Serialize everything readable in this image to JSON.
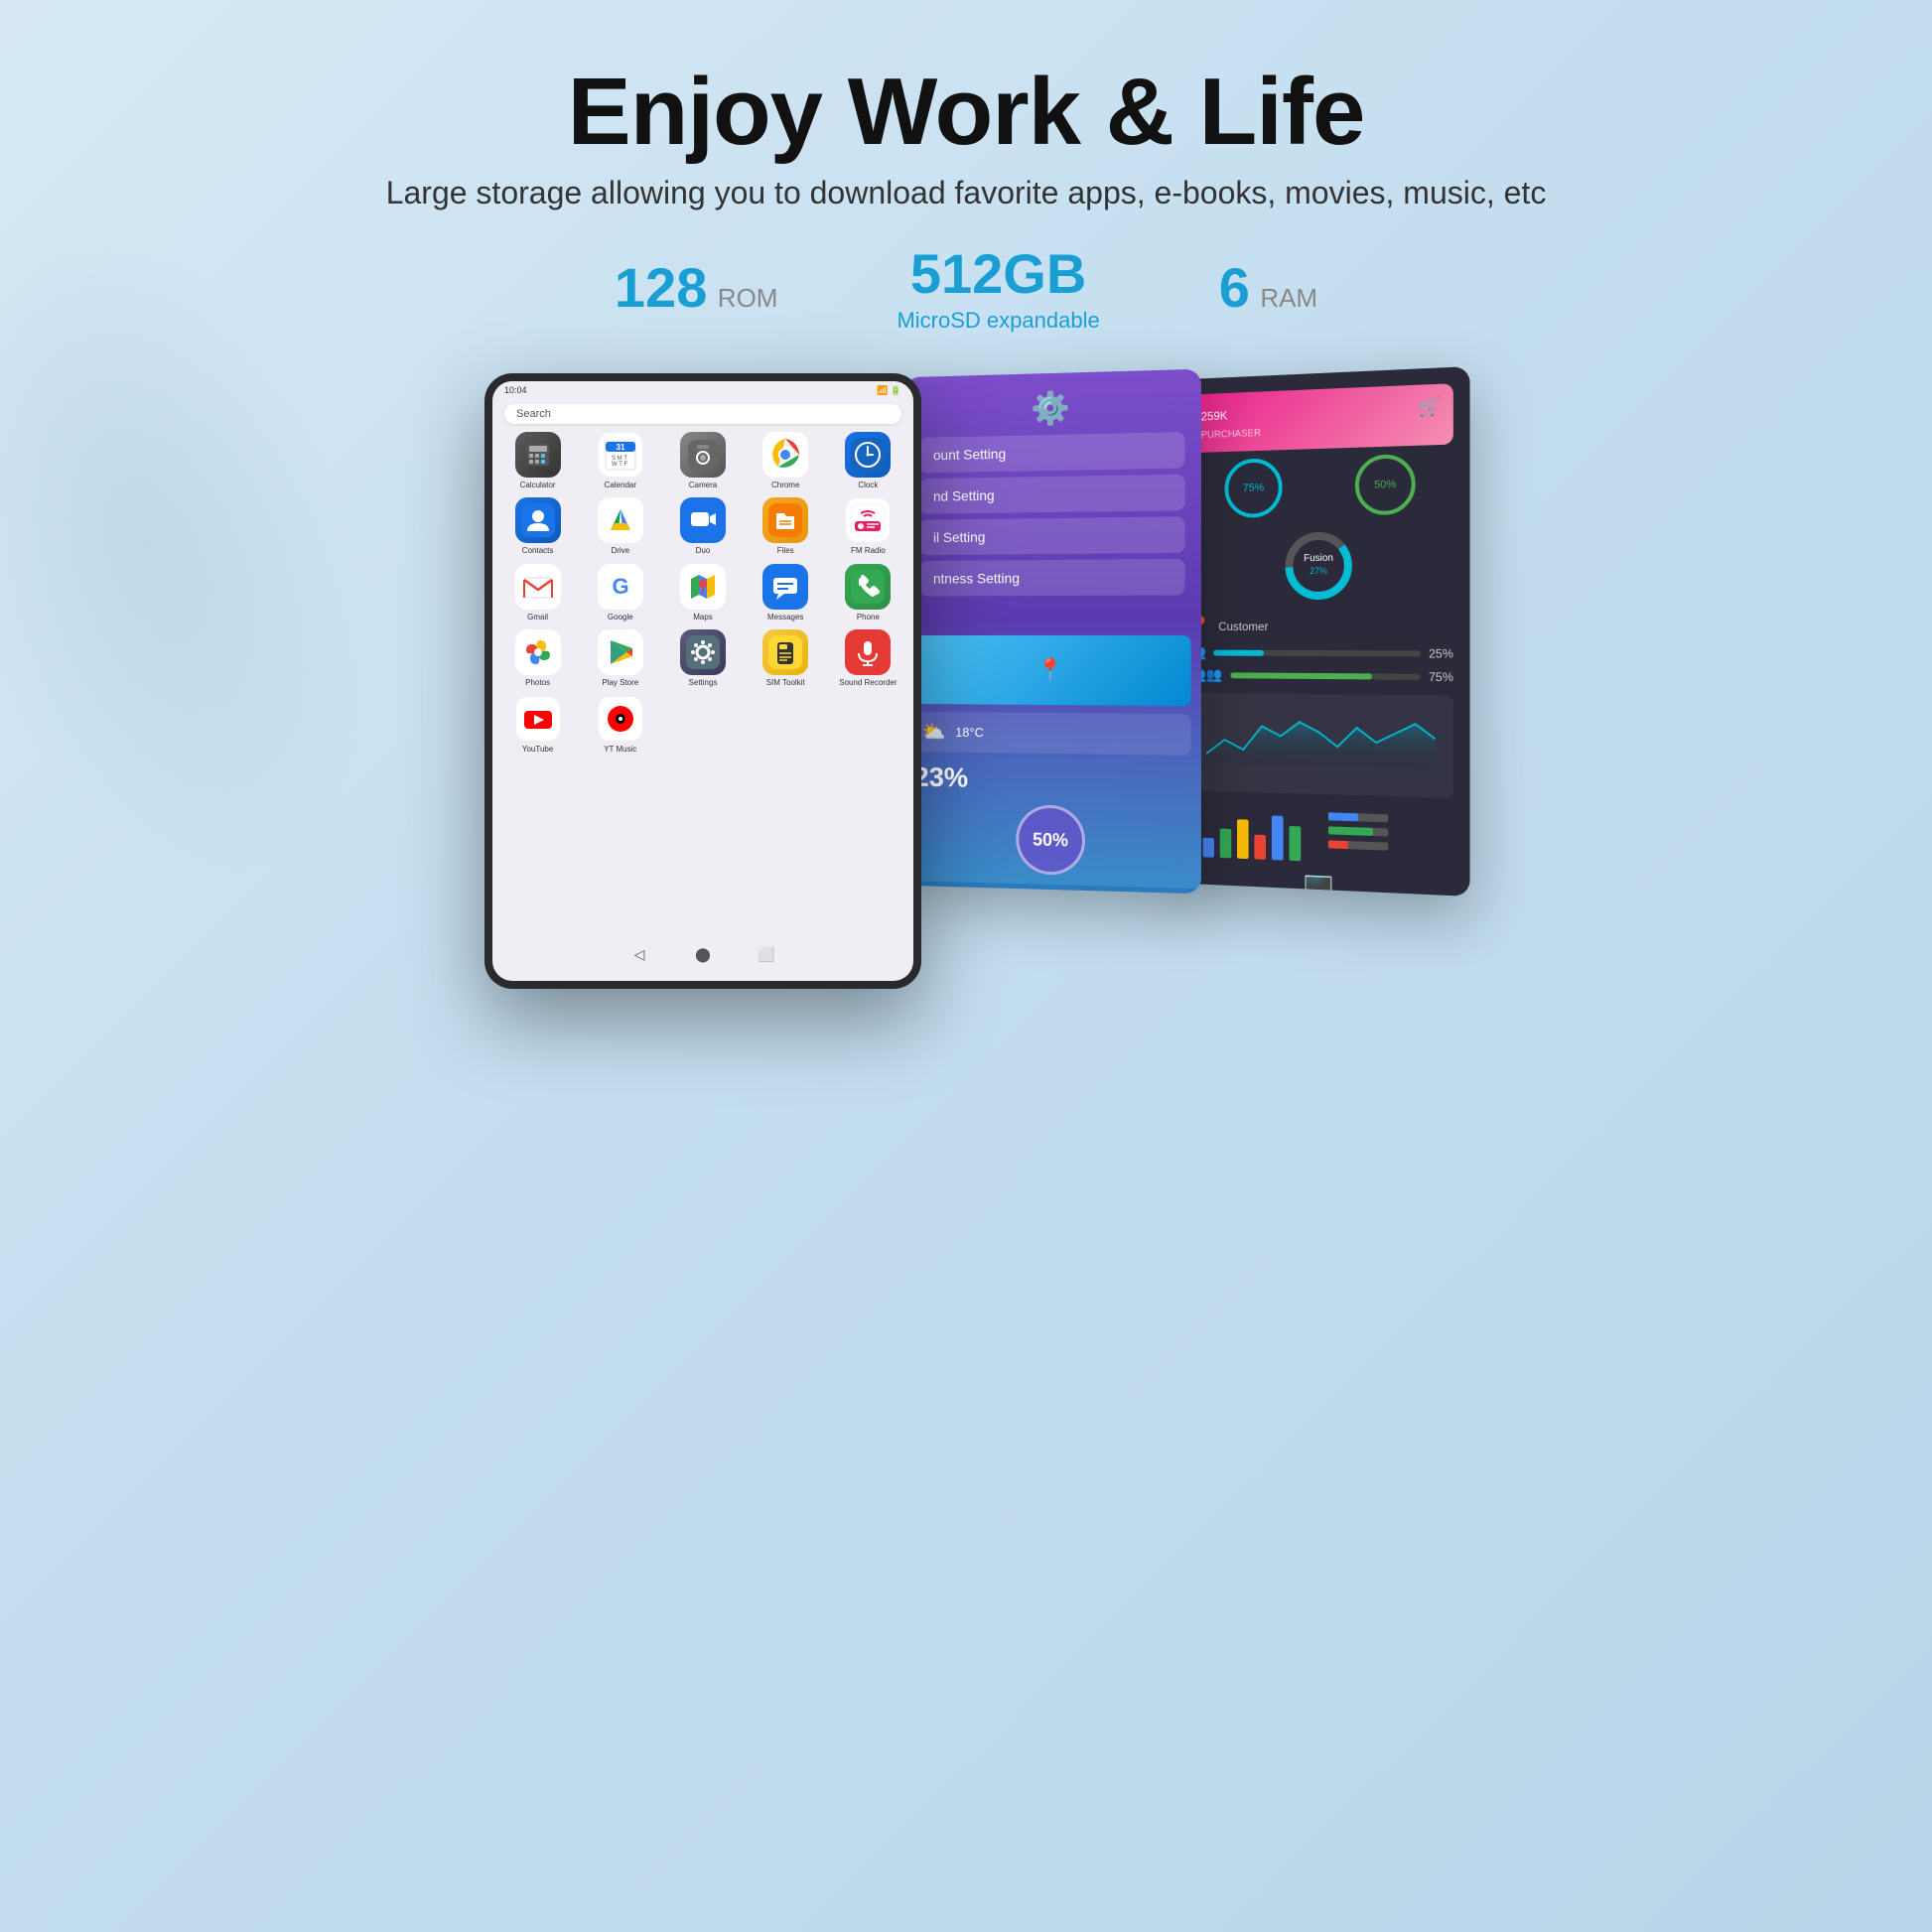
{
  "header": {
    "title": "Enjoy Work & Life",
    "subtitle": "Large storage allowing you to download favorite apps, e-books, movies, music, etc"
  },
  "specs": [
    {
      "number": "128",
      "unit": "ROM",
      "sublabel": ""
    },
    {
      "number": "512GB",
      "unit": "",
      "sublabel": "MicroSD expandable"
    },
    {
      "number": "6",
      "unit": "RAM",
      "sublabel": ""
    }
  ],
  "tablet": {
    "statusBar": "10:04",
    "searchPlaceholder": "Search",
    "apps": [
      {
        "id": "calculator",
        "label": "Calculator",
        "icon": "🔢",
        "colorClass": "icon-calculator"
      },
      {
        "id": "calendar",
        "label": "Calendar",
        "icon": "📅",
        "colorClass": "icon-calendar"
      },
      {
        "id": "camera",
        "label": "Camera",
        "icon": "📷",
        "colorClass": "icon-camera"
      },
      {
        "id": "chrome",
        "label": "Chrome",
        "icon": "🌐",
        "colorClass": "icon-chrome"
      },
      {
        "id": "clock",
        "label": "Clock",
        "icon": "⏰",
        "colorClass": "icon-clock"
      },
      {
        "id": "contacts",
        "label": "Contacts",
        "icon": "👤",
        "colorClass": "icon-contacts"
      },
      {
        "id": "drive",
        "label": "Drive",
        "icon": "▲",
        "colorClass": "icon-drive"
      },
      {
        "id": "duo",
        "label": "Duo",
        "icon": "📹",
        "colorClass": "icon-duo"
      },
      {
        "id": "files",
        "label": "Files",
        "icon": "📁",
        "colorClass": "icon-files"
      },
      {
        "id": "fmradio",
        "label": "FM Radio",
        "icon": "📻",
        "colorClass": "icon-fmradio"
      },
      {
        "id": "gmail",
        "label": "Gmail",
        "icon": "✉",
        "colorClass": "icon-gmail"
      },
      {
        "id": "google",
        "label": "Google",
        "icon": "G",
        "colorClass": "icon-google"
      },
      {
        "id": "maps",
        "label": "Maps",
        "icon": "🗺",
        "colorClass": "icon-maps"
      },
      {
        "id": "messages",
        "label": "Messages",
        "icon": "💬",
        "colorClass": "icon-messages"
      },
      {
        "id": "phone",
        "label": "Phone",
        "icon": "📞",
        "colorClass": "icon-phone"
      },
      {
        "id": "photos",
        "label": "Photos",
        "icon": "🌸",
        "colorClass": "icon-photos"
      },
      {
        "id": "playstore",
        "label": "Play Store",
        "icon": "▶",
        "colorClass": "icon-playstore"
      },
      {
        "id": "settings",
        "label": "Settings",
        "icon": "⚙",
        "colorClass": "icon-settings"
      },
      {
        "id": "simtoolkit",
        "label": "SIM Toolkit",
        "icon": "📋",
        "colorClass": "icon-simtoolkit"
      },
      {
        "id": "soundrecorder",
        "label": "Sound Recorder",
        "icon": "🎤",
        "colorClass": "icon-soundrecorder"
      },
      {
        "id": "youtube",
        "label": "YouTube",
        "icon": "▶",
        "colorClass": "icon-youtube"
      },
      {
        "id": "ytmusic",
        "label": "YT Music",
        "icon": "🎵",
        "colorClass": "icon-ytmusic"
      }
    ]
  },
  "dashboard": {
    "gauge1": "75%",
    "gauge2": "50%",
    "stat1_label": "25%",
    "stat2_label": "75%",
    "percentage": "50%",
    "chart_value": "23%"
  },
  "settings_menu": [
    "ount Setting",
    "nd Setting",
    "il Setting",
    "ntness Setting"
  ]
}
